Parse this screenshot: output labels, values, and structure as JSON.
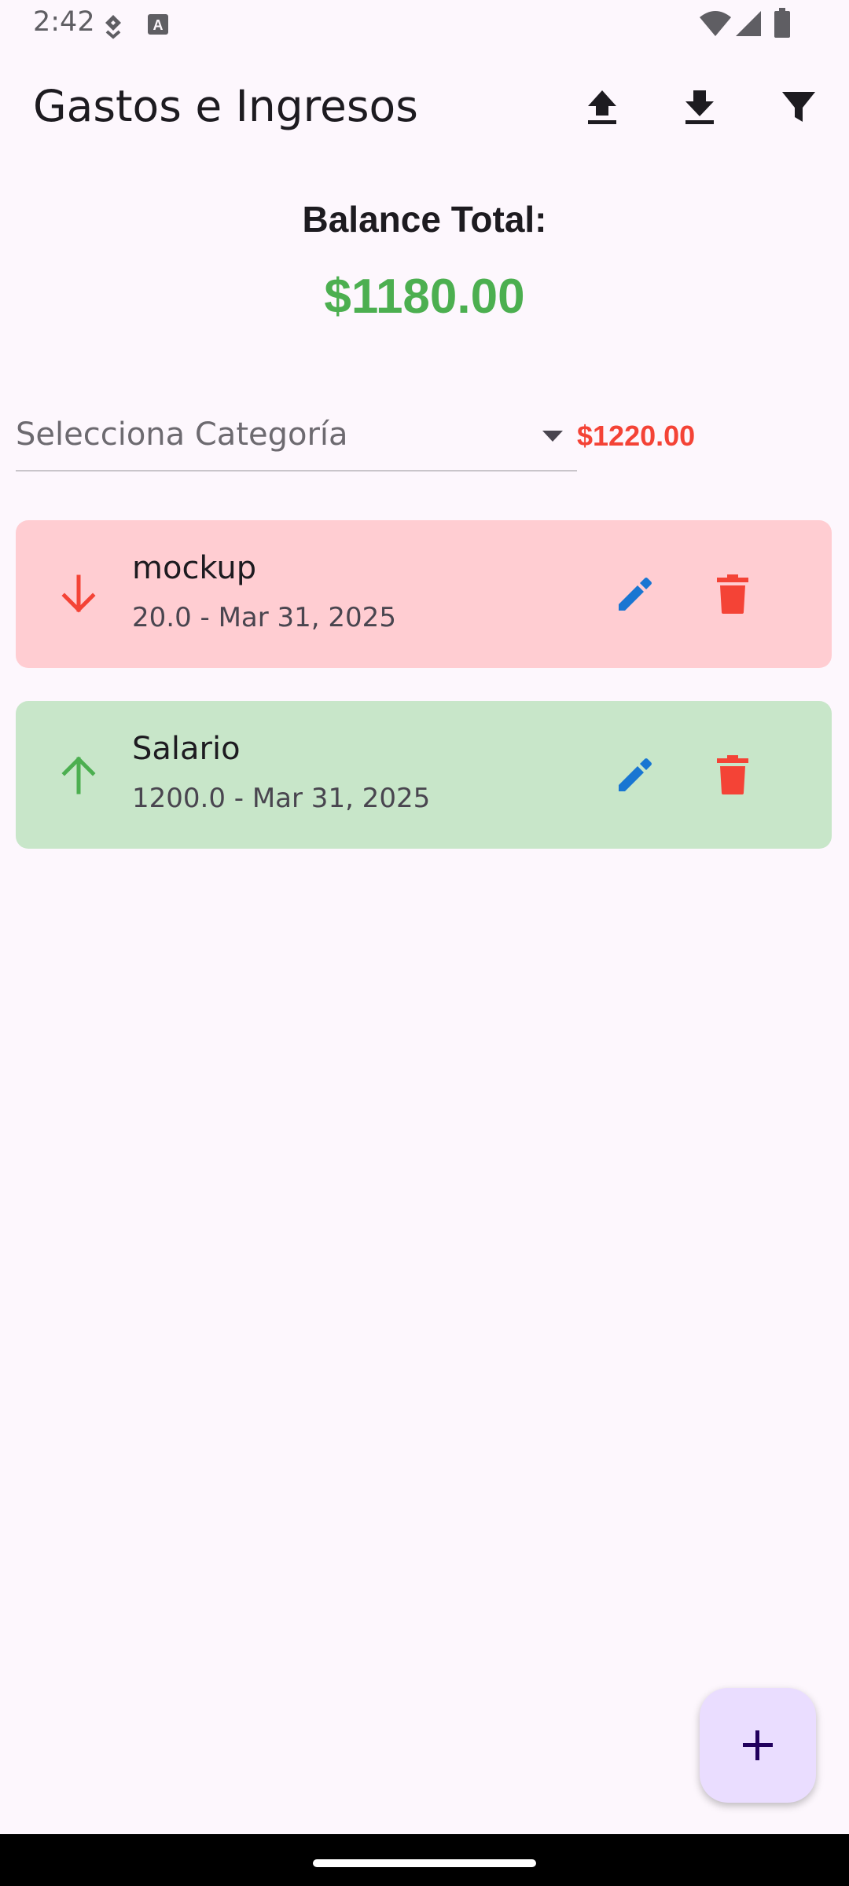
{
  "status_bar": {
    "time": "2:42"
  },
  "app_bar": {
    "title": "Gastos e Ingresos",
    "actions": [
      "upload-icon",
      "download-icon",
      "filter-icon"
    ]
  },
  "balance": {
    "label": "Balance Total:",
    "value": "$1180.00",
    "color": "#4caf50"
  },
  "filter": {
    "placeholder": "Selecciona Categoría",
    "total": "$1220.00",
    "total_color": "#f44336"
  },
  "transactions": [
    {
      "title": "mockup",
      "subtitle": "20.0 - Mar 31, 2025",
      "type": "expense",
      "direction_icon": "arrow-down-icon",
      "background": "#ffcdd2",
      "icon_color": "#f44336"
    },
    {
      "title": "Salario",
      "subtitle": "1200.0 - Mar 31, 2025",
      "type": "income",
      "direction_icon": "arrow-up-icon",
      "background": "#c8e6c9",
      "icon_color": "#4caf50"
    }
  ],
  "colors": {
    "edit": "#1976d2",
    "delete": "#f44336",
    "fab_bg": "#eaddff"
  },
  "fab": {
    "icon": "plus-icon"
  }
}
